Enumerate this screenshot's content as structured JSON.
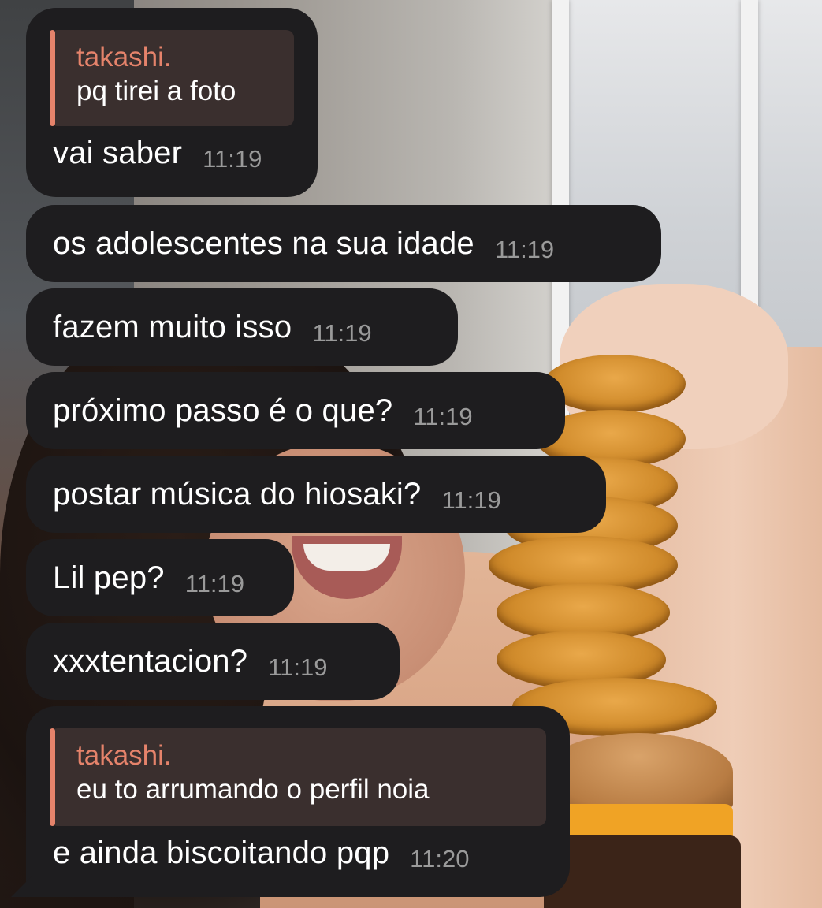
{
  "messages": [
    {
      "reply": {
        "name": "takashi.",
        "text": "pq tirei a foto"
      },
      "text": "vai saber",
      "time": "11:19"
    },
    {
      "text": "os adolescentes na sua idade",
      "time": "11:19"
    },
    {
      "text": "fazem muito isso",
      "time": "11:19"
    },
    {
      "text": "próximo passo é o que?",
      "time": "11:19"
    },
    {
      "text": "postar música do hiosaki?",
      "time": "11:19"
    },
    {
      "text": "Lil pep?",
      "time": "11:19"
    },
    {
      "text": "xxxtentacion?",
      "time": "11:19"
    },
    {
      "reply": {
        "name": "takashi.",
        "text": "eu to arrumando o perfil noia"
      },
      "text": "e ainda biscoitando pqp",
      "time": "11:20"
    }
  ],
  "colors": {
    "bubble": "#1e1d1f",
    "reply_accent": "#e5836b",
    "reply_bg": "#3a2f2e",
    "time": "#9a9a9a",
    "text": "#ffffff"
  }
}
